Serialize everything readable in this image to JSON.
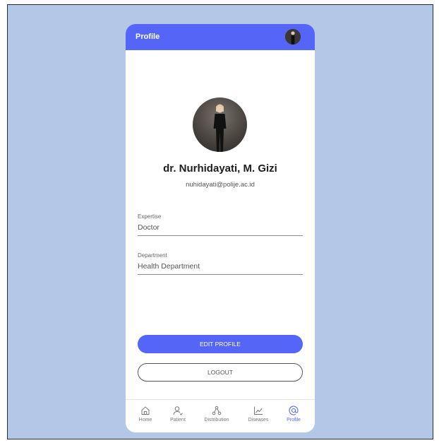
{
  "appbar": {
    "title": "Profile"
  },
  "profile": {
    "name": "dr. Nurhidayati, M. Gizi",
    "email": "nuhidayati@polije.ac.id"
  },
  "fields": [
    {
      "label": "Expertise",
      "value": "Doctor"
    },
    {
      "label": "Department",
      "value": "Health Department"
    }
  ],
  "buttons": {
    "edit": "EDIT PROFILE",
    "logout": "LOGOUT"
  },
  "nav": [
    {
      "label": "Home",
      "icon": "home-icon"
    },
    {
      "label": "Patient",
      "icon": "patient-icon"
    },
    {
      "label": "Distribution",
      "icon": "distribution-icon"
    },
    {
      "label": "Diseases",
      "icon": "chart-icon"
    },
    {
      "label": "Profile",
      "icon": "at-icon",
      "active": true
    }
  ],
  "colors": {
    "accent": "#5565f7",
    "background": "#b4c7e7",
    "text": "#1d1d1f"
  }
}
